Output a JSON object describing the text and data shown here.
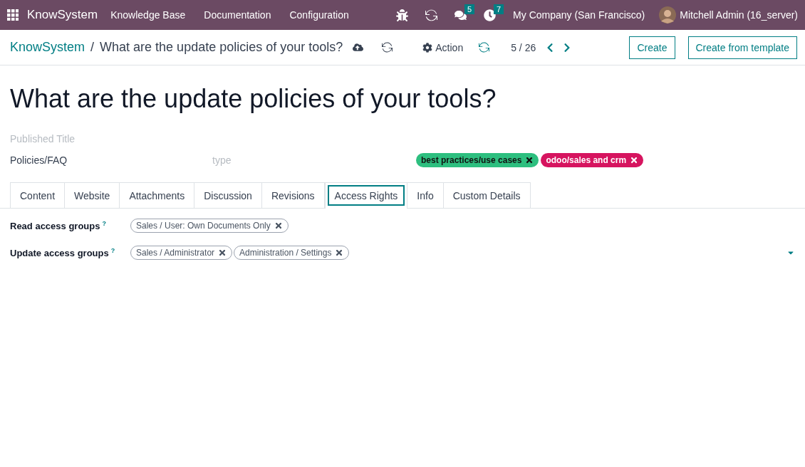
{
  "navbar": {
    "app_name": "KnowSystem",
    "menu": [
      "Knowledge Base",
      "Documentation",
      "Configuration"
    ],
    "messages_count": "5",
    "activities_count": "7",
    "company": "My Company (San Francisco)",
    "user": "Mitchell Admin (16_server)"
  },
  "control_panel": {
    "breadcrumb_root": "KnowSystem",
    "breadcrumb_separator": "/",
    "breadcrumb_current": "What are the update policies of your tools?",
    "action": "Action",
    "pager": "5 / 26",
    "buttons": [
      "Create",
      "Create from template"
    ]
  },
  "form": {
    "title": "What are the update policies of your tools?",
    "published_title": {
      "placeholder": "Published Title"
    },
    "section": {
      "value": "Policies/FAQ"
    },
    "type": {
      "placeholder": "type"
    },
    "tags": [
      {
        "label": "best practices/use cases",
        "color": "#2dbf7f"
      },
      {
        "label": "odoo/sales and crm",
        "color": "#d6145f"
      }
    ],
    "tabs": [
      {
        "label": "Content",
        "selected": false
      },
      {
        "label": "Website",
        "selected": false
      },
      {
        "label": "Attachments",
        "selected": false
      },
      {
        "label": "Discussion",
        "selected": false
      },
      {
        "label": "Revisions",
        "selected": false
      },
      {
        "label": "Access Rights",
        "selected": true
      },
      {
        "label": "Info",
        "selected": false
      },
      {
        "label": "Custom Details",
        "selected": false
      }
    ],
    "fields": [
      {
        "label": "Read access groups",
        "help": "?",
        "groups": [
          "Sales / User: Own Documents Only"
        ]
      },
      {
        "label": "Update access groups",
        "help": "?",
        "groups": [
          "Sales / Administrator",
          "Administration / Settings"
        ]
      }
    ]
  }
}
